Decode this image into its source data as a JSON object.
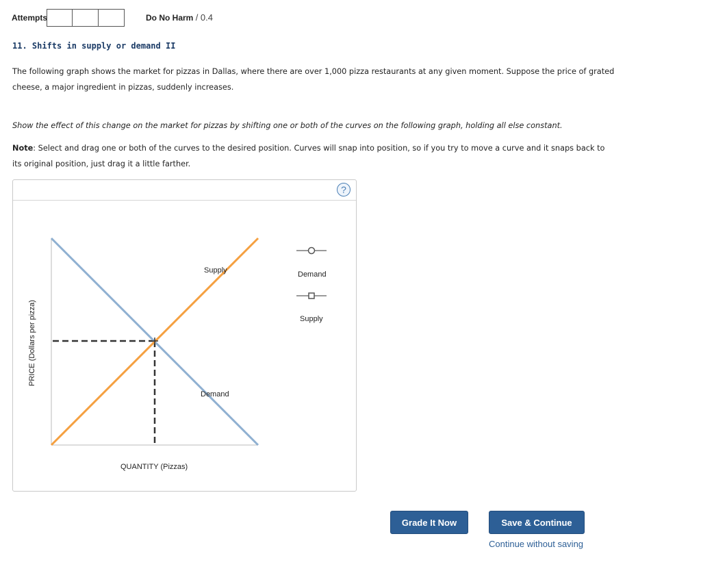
{
  "header": {
    "attempts_label": "Attempts",
    "attempt_box_count": 3,
    "harm_label": "Do No Harm",
    "harm_score": "/ 0.4"
  },
  "question": {
    "title": "11. Shifts in supply or demand II",
    "paragraph1": "The following graph shows the market for pizzas in Dallas, where there are over 1,000 pizza restaurants at any given moment. Suppose the price of grated cheese, a major ingredient in pizzas, suddenly increases.",
    "instruction": "Show the effect of this change on the market for pizzas by shifting one or both of the curves on the following graph, holding all else constant.",
    "note_label": "Note",
    "note_text": ": Select and drag one or both of the curves to the desired position. Curves will snap into position, so if you try to move a curve and it snaps back to its original position, just drag it a little farther."
  },
  "graph": {
    "help_symbol": "?",
    "y_axis_label": "PRICE (Dollars per pizza)",
    "x_axis_label": "QUANTITY (Pizzas)",
    "supply_label": "Supply",
    "demand_label": "Demand",
    "legend_demand": "Demand",
    "legend_supply": "Supply",
    "colors": {
      "supply": "#f5a040",
      "demand": "#8fb0d1",
      "guide": "#333333",
      "legend_marker": "#9a9a9a"
    },
    "palette_icons": [
      "circle-marker-icon",
      "square-marker-icon"
    ]
  },
  "buttons": {
    "grade": "Grade It Now",
    "save": "Save & Continue",
    "continue_link": "Continue without saving"
  }
}
